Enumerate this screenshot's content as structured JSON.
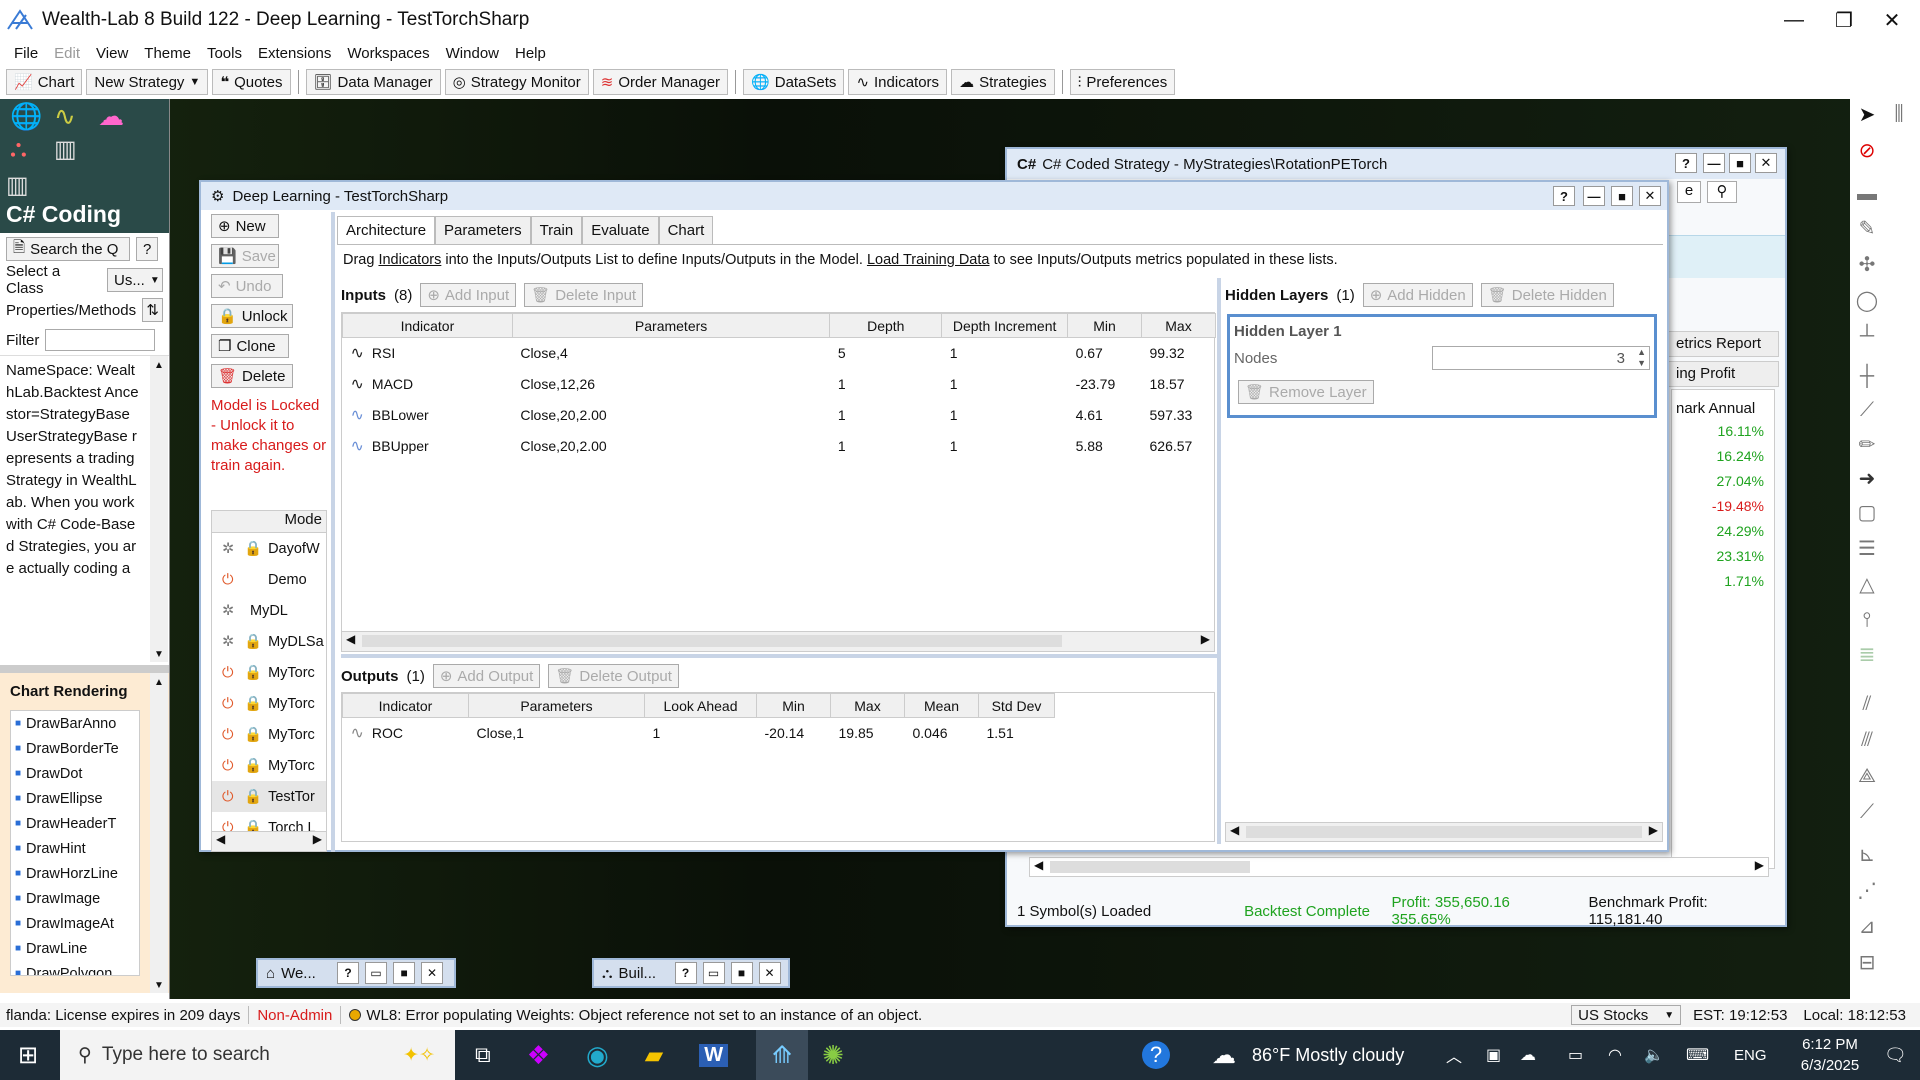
{
  "app": {
    "title": "Wealth-Lab 8 Build 122 - Deep Learning - TestTorchSharp"
  },
  "menu": [
    "File",
    "Edit",
    "View",
    "Theme",
    "Tools",
    "Extensions",
    "Workspaces",
    "Window",
    "Help"
  ],
  "toolbar": {
    "chart": "Chart",
    "new_strategy": "New Strategy",
    "quotes": "Quotes",
    "data_manager": "Data Manager",
    "strategy_monitor": "Strategy Monitor",
    "order_manager": "Order Manager",
    "datasets": "DataSets",
    "indicators": "Indicators",
    "strategies": "Strategies",
    "preferences": "Preferences"
  },
  "left": {
    "title": "C# Coding Q...",
    "search_btn": "Search the Q",
    "help": "?",
    "select_class_label": "Select a Class",
    "select_class_value": "Us...",
    "props_label": "Properties/Methods",
    "filter_label": "Filter",
    "description": "NameSpace: WealthLab.Backtest Ancestor=StrategyBase UserStrategyBase represents a trading Strategy in WealthLab. When you work with C# Code-Based Strategies, you are actually coding a",
    "chart_rendering": "Chart Rendering",
    "methods": [
      "DrawBarAnno",
      "DrawBorderTe",
      "DrawDot",
      "DrawEllipse",
      "DrawHeaderT",
      "DrawHint",
      "DrawHorzLine",
      "DrawImage",
      "DrawImageAt",
      "DrawLine",
      "DrawPolygon"
    ]
  },
  "csharp": {
    "title": "C# Coded Strategy - MyStrategies\\RotationPETorch",
    "help": "?",
    "e_label": "e",
    "metrics_report": "etrics Report",
    "ing_profit": "ing Profit",
    "mark_annual": "nark Annual",
    "values": [
      "16.11%",
      "16.24%",
      "27.04%",
      "-19.48%",
      "24.29%",
      "23.31%",
      "1.71%"
    ],
    "symbols_loaded": "1 Symbol(s) Loaded",
    "backtest": "Backtest Complete",
    "profit": "Profit: 355,650.16 355.65%",
    "benchmark": "Benchmark Profit: 115,181.40"
  },
  "dl": {
    "title": "Deep Learning - TestTorchSharp",
    "help": "?",
    "buttons": {
      "new": "New",
      "save": "Save",
      "undo": "Undo",
      "unlock": "Unlock",
      "clone": "Clone",
      "delete": "Delete"
    },
    "locked_msg": "Model is Locked - Unlock it to make changes or train again.",
    "models_header": "Mode",
    "models": [
      "DayofW",
      "Demo",
      "MyDL",
      "MyDLSa",
      "MyTorc",
      "MyTorc",
      "MyTorc",
      "MyTorc",
      "TestTor",
      "Torch L"
    ],
    "tabs": [
      "Architecture",
      "Parameters",
      "Train",
      "Evaluate",
      "Chart"
    ],
    "info": {
      "p1": "Drag ",
      "link1": "Indicators",
      "p2": " into the Inputs/Outputs List to define Inputs/Outputs in the Model. ",
      "link2": "Load Training Data",
      "p3": " to see Inputs/Outputs metrics populated in these lists."
    },
    "inputs": {
      "label": "Inputs",
      "count": "(8)",
      "add": "Add Input",
      "delete": "Delete Input",
      "headers": [
        "Indicator",
        "Parameters",
        "Depth",
        "Depth Increment",
        "Min",
        "Max"
      ],
      "rows": [
        [
          "RSI",
          "Close,4",
          "5",
          "1",
          "0.67",
          "99.32"
        ],
        [
          "MACD",
          "Close,12,26",
          "1",
          "1",
          "-23.79",
          "18.57"
        ],
        [
          "BBLower",
          "Close,20,2.00",
          "1",
          "1",
          "4.61",
          "597.33"
        ],
        [
          "BBUpper",
          "Close,20,2.00",
          "1",
          "1",
          "5.88",
          "626.57"
        ]
      ]
    },
    "outputs": {
      "label": "Outputs",
      "count": "(1)",
      "add": "Add Output",
      "delete": "Delete Output",
      "headers": [
        "Indicator",
        "Parameters",
        "Look Ahead",
        "Min",
        "Max",
        "Mean",
        "Std Dev"
      ],
      "rows": [
        [
          "ROC",
          "Close,1",
          "1",
          "-20.14",
          "19.85",
          "0.046",
          "1.51"
        ]
      ]
    },
    "hidden": {
      "label": "Hidden Layers",
      "count": "(1)",
      "add": "Add Hidden",
      "delete": "Delete Hidden",
      "layer_title": "Hidden Layer 1",
      "nodes_label": "Nodes",
      "nodes_value": "3",
      "remove": "Remove Layer"
    }
  },
  "mini": {
    "we": "We...",
    "bui": "Buil..."
  },
  "status": {
    "license": "flanda: License expires in 209 days",
    "nonadmin": "Non-Admin",
    "error": "WL8: Error populating Weights: Object reference not set to an instance of an object.",
    "market": "US Stocks",
    "est": "EST: 19:12:53",
    "local": "Local: 18:12:53"
  },
  "taskbar": {
    "search": "Type here to search",
    "weather": "86°F  Mostly cloudy",
    "lang": "ENG",
    "time": "6:12 PM",
    "date": "6/3/2025"
  }
}
